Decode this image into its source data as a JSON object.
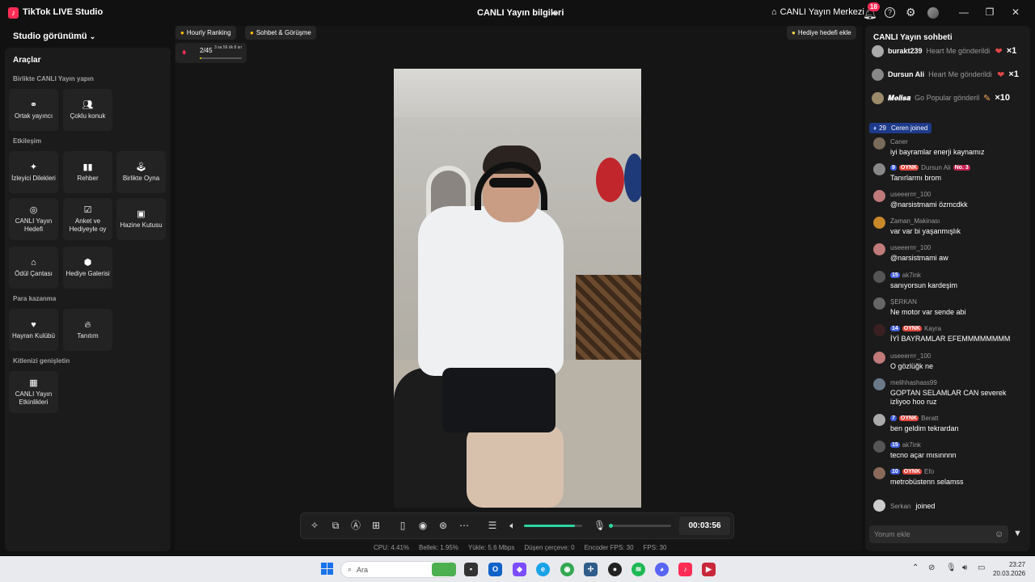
{
  "titlebar": {
    "app_title": "TikTok LIVE Studio",
    "center_title": "CANLI Yayın bilgileri",
    "live_center": "CANLI Yayın Merkezi",
    "notification_count": "18"
  },
  "left": {
    "studio_view": "Studio görünümü",
    "tools_title": "Araçlar",
    "sections": {
      "together": "Birlikte CANLI Yayın yapın",
      "engagement": "Etkileşim",
      "monetize": "Para kazanma",
      "grow": "Kitlenizi genişletin"
    },
    "tiles": {
      "cohost": "Ortak yayıncı",
      "multiguest": "Çoklu konuk",
      "viewer_wishes": "İzleyici Dilekleri",
      "guide": "Rehber",
      "play_together": "Birlikte Oyna",
      "live_goal": "CANLI Yayın Hedefi",
      "poll": "Anket ve Hediyeyle oy",
      "treasure": "Hazine Kutusu",
      "reward_bag": "Ödül Çantası",
      "gift_gallery": "Hediye Galerisi",
      "fan_club": "Hayran Kulübü",
      "promote": "Tanıtım",
      "live_events": "CANLI Yayın Etkinlikleri"
    }
  },
  "stage": {
    "hourly_ranking": "Hourly Ranking",
    "chat_meet": "Sohbet & Görüşme",
    "gift_goal": "Hediye hedefi ekle",
    "rank_value": "2/45",
    "rank_time": "3 sa 56 dk 8 sn",
    "rank_progress": 0.04,
    "timer": "00:03:56",
    "volume_level": 0.87,
    "mic_level": 0.0
  },
  "stats": {
    "cpu": "CPU:  4.41%",
    "memory": "Bellek:  1.95%",
    "upload": "Yükle:  5.6 Mbps",
    "dropped": "Düşen çerçeve:  0",
    "encoder_fps": "Encoder FPS:  30",
    "fps": "FPS:  30"
  },
  "chat": {
    "title": "CANLI Yayın sohbeti",
    "gifts": [
      {
        "user": "burakt239",
        "action": "Heart Me gönderildi",
        "count": "×1"
      },
      {
        "user": "Dursun Ali",
        "action": "Heart Me gönderildi",
        "count": "×1"
      },
      {
        "user": "𝑴𝒆𝒍𝒊𝒔𝒂",
        "action": "Go Popular gönderildi",
        "count": "×10"
      }
    ],
    "join_level": "29",
    "join_text": "Ceren joined",
    "messages": [
      {
        "user": "Caner",
        "text": "iyi bayramlar enerji kaynamız"
      },
      {
        "level": "9",
        "tag": "OYNK",
        "user": "Dursun Ali",
        "badge": "No. 3",
        "text": "Tanırlarmı brom"
      },
      {
        "user": "useeerrrr_100",
        "text": "@narsistmami özmcdkk"
      },
      {
        "user": "Zaman_Makinası",
        "text": "var var bi yaşanmışlık"
      },
      {
        "user": "useeerrrr_100",
        "text": "@narsistmami aw"
      },
      {
        "level": "15",
        "user": "ak7ink",
        "text": "sanıyorsun kardeşim"
      },
      {
        "user": "ŞERKAN",
        "text": "Ne motor var sende abi"
      },
      {
        "level": "14",
        "tag": "OYNK",
        "user": "Kayra",
        "text": "İYİ BAYRAMLAR EFEMMMMMMMM"
      },
      {
        "user": "useeerrrr_100",
        "text": "O gözlüğk ne"
      },
      {
        "user": "melihhashass99",
        "text": "GOPTAN SELAMLAR CAN severek izliyoo hoo ruz"
      },
      {
        "level": "7",
        "tag": "OYNK",
        "user": "Beratt",
        "text": "ben geldim tekrardan"
      },
      {
        "level": "15",
        "user": "ak7ink",
        "text": "tecno açar mısınnnn"
      },
      {
        "level": "10",
        "tag": "OYNK",
        "user": "Efo",
        "text": "metrobüstenn selamss"
      }
    ],
    "last_join_user": "Serkan",
    "last_join_text": "joined",
    "comment_placeholder": "Yorum ekle"
  },
  "taskbar": {
    "search": "Ara",
    "time": "23:27",
    "date": "20.03.2026"
  }
}
